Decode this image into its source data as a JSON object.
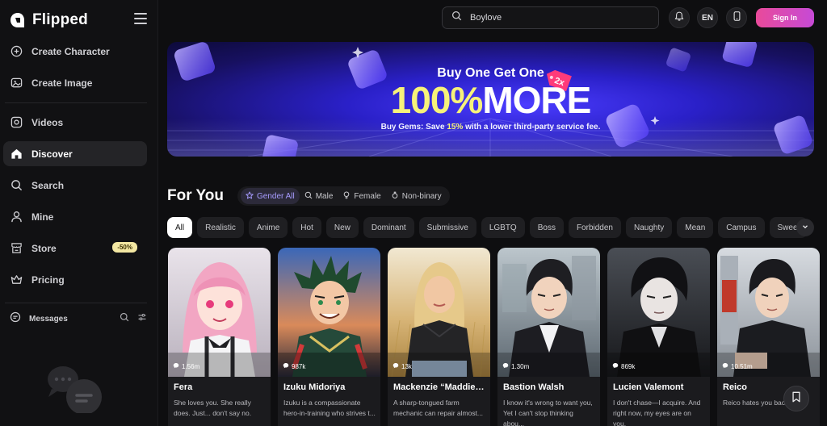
{
  "brand": {
    "name": "Flipped"
  },
  "sidebar": {
    "items": [
      {
        "label": "Create Character",
        "icon": "plus-circle-icon"
      },
      {
        "label": "Create Image",
        "icon": "image-icon"
      },
      {
        "label": "Videos",
        "icon": "video-icon"
      },
      {
        "label": "Discover",
        "icon": "home-icon",
        "active": true
      },
      {
        "label": "Search",
        "icon": "search-icon"
      },
      {
        "label": "Mine",
        "icon": "user-icon"
      },
      {
        "label": "Store",
        "icon": "store-icon",
        "badge": "-50%"
      },
      {
        "label": "Pricing",
        "icon": "crown-icon"
      }
    ],
    "messages_label": "Messages"
  },
  "topbar": {
    "search_value": "Boylove",
    "language": "EN",
    "signin_label": "Sign In"
  },
  "banner": {
    "line1": "Buy One Get One",
    "big_yellow": "100%",
    "big_white": "MORE",
    "sub_prefix": "Buy Gems: Save ",
    "sub_highlight": "15%",
    "sub_suffix": " with a lower third-party service fee.",
    "tag": "2x"
  },
  "for_you": {
    "title": "For You",
    "gender": [
      {
        "label": "Gender All",
        "active": true
      },
      {
        "label": "Male"
      },
      {
        "label": "Female"
      },
      {
        "label": "Non-binary"
      }
    ],
    "tags": [
      "All",
      "Realistic",
      "Anime",
      "Hot",
      "New",
      "Dominant",
      "Submissive",
      "LGBTQ",
      "Boss",
      "Forbidden",
      "Naughty",
      "Mean",
      "Campus",
      "Sweet"
    ]
  },
  "cards": [
    {
      "name": "Fera",
      "views": "1.56m",
      "desc": "She loves you. She really does. Just... don't say no."
    },
    {
      "name": "Izuku Midoriya",
      "views": "987k",
      "desc": "Izuku is a compassionate hero-in-training who strives t..."
    },
    {
      "name": "Mackenzie “Maddie”...",
      "views": "13k",
      "desc": "A sharp-tongued farm mechanic can repair almost..."
    },
    {
      "name": "Bastion Walsh",
      "views": "1.30m",
      "desc": "I know it's wrong to want you, Yet I can't stop thinking abou..."
    },
    {
      "name": "Lucien Valemont",
      "views": "869k",
      "desc": "I don't chase—I acquire. And right now, my eyes are on you."
    },
    {
      "name": "Reico",
      "views": "10.51m",
      "desc": "Reico hates you bac..."
    }
  ],
  "colors": {
    "accent": "#e94a9a",
    "active_gender": "#a79cff",
    "badge": "#f3e7a2",
    "banner_yellow": "#f6f27a"
  }
}
